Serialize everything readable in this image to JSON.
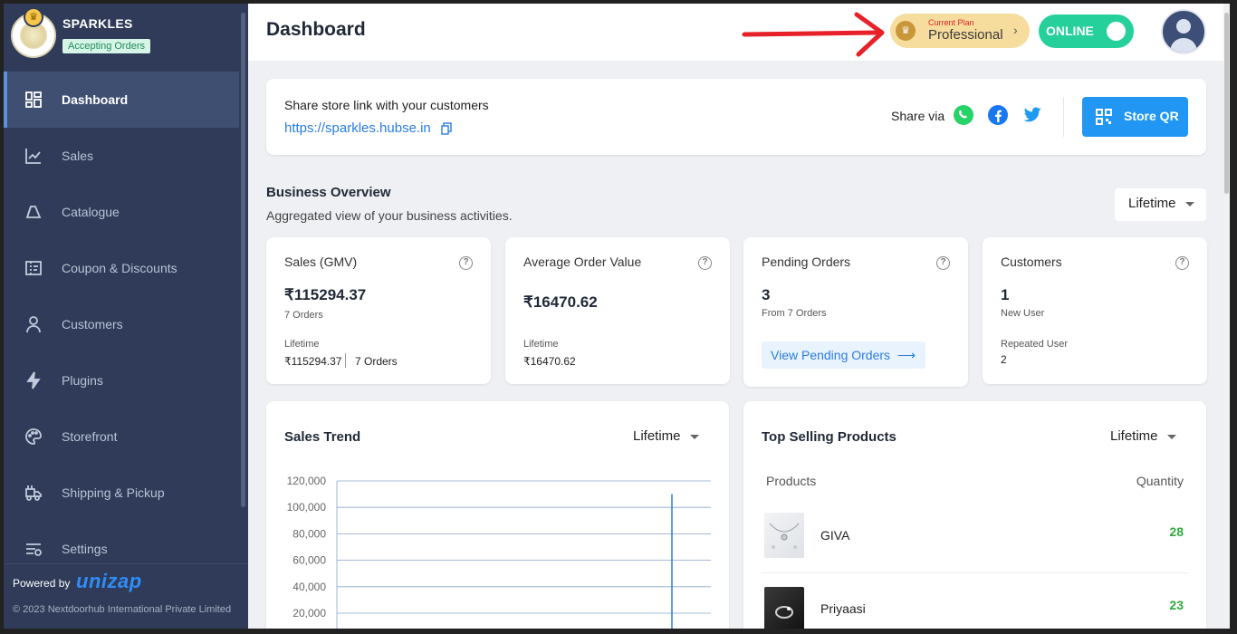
{
  "sidebar": {
    "store_name": "SPARKLES",
    "status_badge": "Accepting Orders",
    "items": [
      {
        "label": "Dashboard",
        "icon": "dashboard-icon"
      },
      {
        "label": "Sales",
        "icon": "chart-line-icon"
      },
      {
        "label": "Catalogue",
        "icon": "catalogue-tag-icon"
      },
      {
        "label": "Coupon & Discounts",
        "icon": "coupon-icon"
      },
      {
        "label": "Customers",
        "icon": "user-icon"
      },
      {
        "label": "Plugins",
        "icon": "lightning-icon"
      },
      {
        "label": "Storefront",
        "icon": "palette-icon"
      },
      {
        "label": "Shipping & Pickup",
        "icon": "truck-icon"
      },
      {
        "label": "Settings",
        "icon": "settings-sliders-icon"
      }
    ],
    "powered_by": "Powered by",
    "powered_brand": "Unizap",
    "copyright": "© 2023 Nextdoorhub International Private Limited"
  },
  "header": {
    "title": "Dashboard",
    "plan_label": "Current Plan",
    "plan_name": "Professional",
    "online_label": "ONLINE"
  },
  "share": {
    "label": "Share store link with your customers",
    "link": "https://sparkles.hubse.in",
    "via_label": "Share via",
    "qr_label": "Store QR"
  },
  "business_overview": {
    "title": "Business Overview",
    "subtitle": "Aggregated view of your business activities.",
    "range": "Lifetime"
  },
  "stats": {
    "sales": {
      "title": "Sales (GMV)",
      "value": "₹115294.37",
      "orders": "7 Orders",
      "footer_label": "Lifetime",
      "footer_value": "₹115294.37",
      "footer_orders": "7 Orders"
    },
    "aov": {
      "title": "Average Order Value",
      "value": "₹16470.62",
      "footer_label": "Lifetime",
      "footer_value": "₹16470.62"
    },
    "pending": {
      "title": "Pending Orders",
      "value": "3",
      "sub": "From 7 Orders",
      "button": "View Pending Orders"
    },
    "customers": {
      "title": "Customers",
      "value": "1",
      "sub": "New User",
      "repeat_label": "Repeated User",
      "repeat_value": "2"
    }
  },
  "sales_trend": {
    "title": "Sales Trend",
    "range": "Lifetime",
    "y_ticks": [
      "120,000",
      "100,000",
      "80,000",
      "60,000",
      "40,000",
      "20,000"
    ]
  },
  "chart_data": {
    "type": "line",
    "title": "Sales Trend",
    "y_ticks": [
      120000,
      100000,
      80000,
      60000,
      40000,
      20000
    ],
    "ylim": [
      0,
      120000
    ],
    "series": [
      {
        "values": [
          110000
        ]
      }
    ],
    "grid": true
  },
  "top_selling": {
    "title": "Top Selling Products",
    "range": "Lifetime",
    "col_products": "Products",
    "col_quantity": "Quantity",
    "rows": [
      {
        "name": "GIVA",
        "qty": "28"
      },
      {
        "name": "Priyaasi",
        "qty": "23"
      }
    ]
  },
  "colors": {
    "sidebar_bg": "#2f3b58",
    "accent_blue": "#2196f3",
    "online_green": "#25d09a",
    "plan_gold": "#f6dd9e",
    "annotation_red": "#e8202a",
    "qty_green": "#2eaa3f"
  }
}
